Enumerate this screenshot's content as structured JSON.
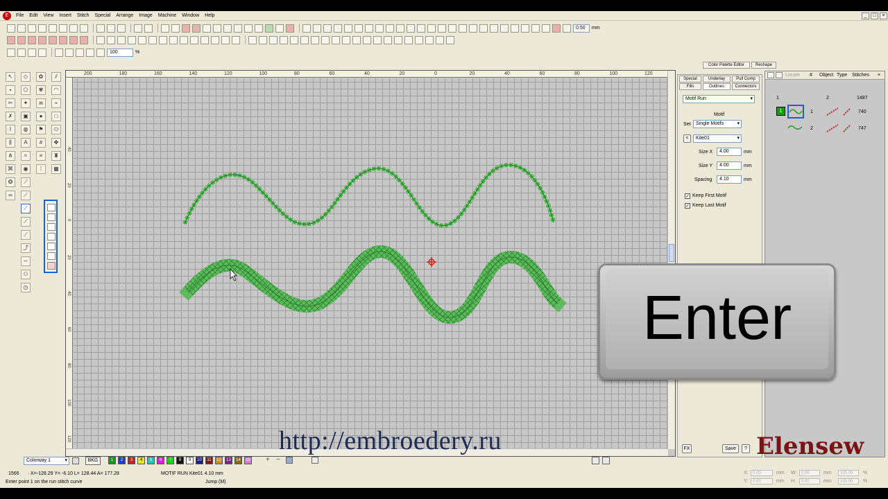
{
  "menu": [
    "File",
    "Edit",
    "View",
    "Insert",
    "Stitch",
    "Special",
    "Arrange",
    "Image",
    "Machine",
    "Window",
    "Help"
  ],
  "toolbar": {
    "offset_value": "0.50",
    "offset_unit": "mm",
    "zoom_value": "100",
    "zoom_unit": "%"
  },
  "ruler": {
    "h_labels": [
      "200",
      "180",
      "160",
      "140",
      "120",
      "100",
      "80",
      "60",
      "40",
      "20",
      "0",
      "20",
      "40",
      "60",
      "80",
      "100",
      "120"
    ],
    "v_labels": [
      "40",
      "20",
      "0",
      "20",
      "40",
      "60",
      "80",
      "100",
      "120"
    ]
  },
  "docked_tabs": [
    "Color Palette Editor",
    "Reshape"
  ],
  "props": {
    "tabs_row1": [
      "Special",
      "Underlay",
      "Pull Comp"
    ],
    "tabs_row2": [
      "Fills",
      "Outlines",
      "Connectors"
    ],
    "stitch_type": "Motif Run",
    "motif_heading": "Motif",
    "set_label": "Set",
    "set_value": "Single Motifs",
    "motif_value": "Kite01",
    "size_x_label": "Size X",
    "size_x_value": "4.00",
    "size_y_label": "Size Y",
    "size_y_value": "4.00",
    "spacing_label": "Spacing",
    "spacing_value": "4.10",
    "unit": "mm",
    "keep_first": "Keep First Motif",
    "keep_last": "Keep Last Motif",
    "fx_label": "FX",
    "save_label": "Save",
    "help_label": "?"
  },
  "objects": {
    "header": [
      "Locate",
      "#",
      "Object",
      "Type",
      "Stitches"
    ],
    "group_row": {
      "left": "1",
      "num": "2",
      "stitches": "1487"
    },
    "rows": [
      {
        "num": "1",
        "stitches": "740"
      },
      {
        "num": "2",
        "stitches": "747"
      }
    ],
    "color_badge": "1"
  },
  "bottom": {
    "colorway": "Colorway 1",
    "bkg": "BKG",
    "swatches": [
      {
        "label": "1",
        "color": "#1a9a1a"
      },
      {
        "label": "2",
        "color": "#1a3ed6"
      },
      {
        "label": "3",
        "color": "#d41a1a"
      },
      {
        "label": "4",
        "color": "#e8e81a"
      },
      {
        "label": "5",
        "color": "#18c8c8"
      },
      {
        "label": "6",
        "color": "#e21ae2"
      },
      {
        "label": "7",
        "color": "#18d418"
      },
      {
        "label": "8",
        "color": "#111111"
      },
      {
        "label": "9",
        "color": "#ffffff"
      },
      {
        "label": "10",
        "color": "#1a1a80"
      },
      {
        "label": "11",
        "color": "#801a1a"
      },
      {
        "label": "12",
        "color": "#d48a1a"
      },
      {
        "label": "13",
        "color": "#8a1a8a"
      },
      {
        "label": "14",
        "color": "#8a6a1a"
      },
      {
        "label": "15",
        "color": "#d87ad8"
      }
    ]
  },
  "status": {
    "count": "1566",
    "coords": "X=-128.29 Y= -6.10 L= 128.44 A= 177.28",
    "motif": "MOTIF RUN  Kite01   4.10 mm",
    "jump": "Jump (M)",
    "hint": "Enter point 1 on the run stitch curve",
    "x_label": "X:",
    "y_label": "Y:",
    "w_label": "W:",
    "h_label": "H:",
    "val": "0.00",
    "pct": "100.00",
    "mm": "mm",
    "percent": "%"
  },
  "overlay": {
    "key_label": "Enter",
    "url": "http://embroedery.ru",
    "brand": "Elensew"
  },
  "colors": {
    "stitch_green": "#4db84d",
    "stitch_dark": "#2a7a2a",
    "accent_blue": "#1a5fd6",
    "cursor_red": "#d42020"
  }
}
